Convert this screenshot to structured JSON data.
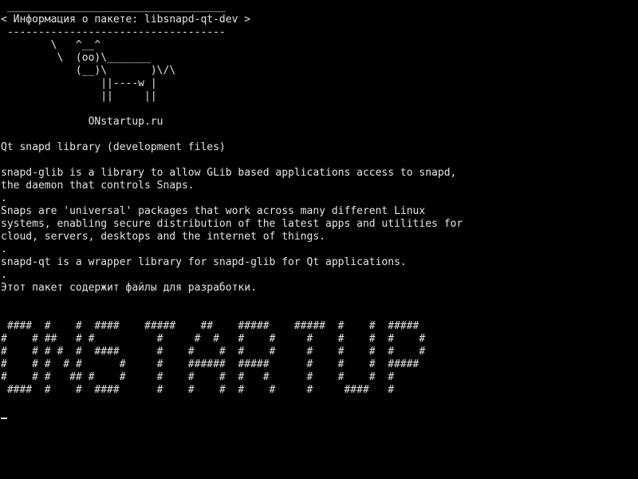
{
  "terminal": {
    "foreground": "#e4e4e4",
    "background": "#000000",
    "lines": [
      " ___________________________________",
      "< Информация о пакете: libsnapd-qt-dev >",
      " -----------------------------------",
      "        \\   ^__^",
      "         \\  (oo)\\_______",
      "            (__)\\       )\\/\\",
      "                ||----w |",
      "                ||     ||",
      "",
      "              ONstartup.ru",
      "",
      "Qt snapd library (development files)",
      "",
      "snapd-glib is a library to allow GLib based applications access to snapd,",
      "the daemon that controls Snaps.",
      ".",
      "Snaps are 'universal' packages that work across many different Linux",
      "systems, enabling secure distribution of the latest apps and utilities for",
      "cloud, servers, desktops and the internet of things.",
      ".",
      "snapd-qt is a wrapper library for snapd-glib for Qt applications.",
      ".",
      "Этот пакет содержит файлы для разработки.",
      "",
      "",
      " ####  #    #  ####    #####    ##    #####    #####  #    #  #####",
      "#    # ##   # #          #     #  #   #    #     #    #    #  #    #",
      "#    # # #  #  ####      #    #    #  #    #     #    #    #  #    #",
      "#    # #  # #      #     #    ######  #####      #    #    #  #####",
      "#    # #   ## #    #     #    #    #  #   #      #    #    #  #",
      " ####  #    #  ####      #    #    #  #    #     #     ####   #"
    ]
  }
}
